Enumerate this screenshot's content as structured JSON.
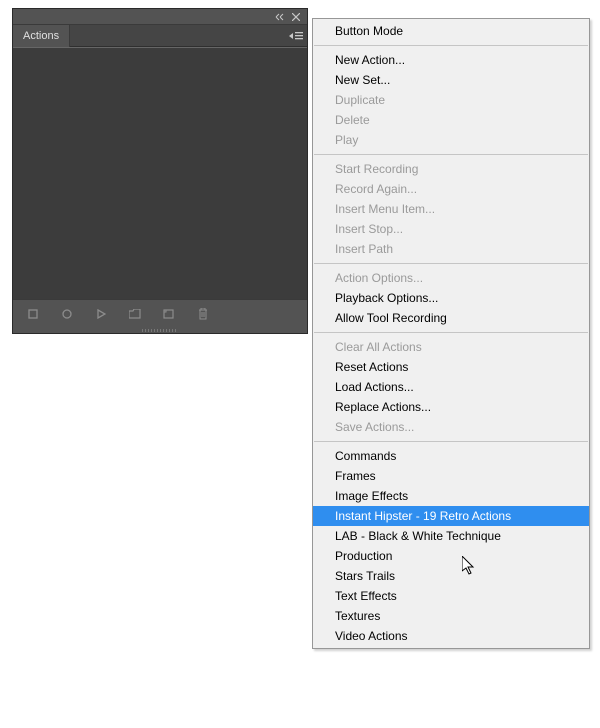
{
  "panel": {
    "tab_label": "Actions"
  },
  "menu": {
    "sections": [
      [
        {
          "label": "Button Mode",
          "enabled": true
        }
      ],
      [
        {
          "label": "New Action...",
          "enabled": true
        },
        {
          "label": "New Set...",
          "enabled": true
        },
        {
          "label": "Duplicate",
          "enabled": false
        },
        {
          "label": "Delete",
          "enabled": false
        },
        {
          "label": "Play",
          "enabled": false
        }
      ],
      [
        {
          "label": "Start Recording",
          "enabled": false
        },
        {
          "label": "Record Again...",
          "enabled": false
        },
        {
          "label": "Insert Menu Item...",
          "enabled": false
        },
        {
          "label": "Insert Stop...",
          "enabled": false
        },
        {
          "label": "Insert Path",
          "enabled": false
        }
      ],
      [
        {
          "label": "Action Options...",
          "enabled": false
        },
        {
          "label": "Playback Options...",
          "enabled": true
        },
        {
          "label": "Allow Tool Recording",
          "enabled": true
        }
      ],
      [
        {
          "label": "Clear All Actions",
          "enabled": false
        },
        {
          "label": "Reset Actions",
          "enabled": true
        },
        {
          "label": "Load Actions...",
          "enabled": true
        },
        {
          "label": "Replace Actions...",
          "enabled": true
        },
        {
          "label": "Save Actions...",
          "enabled": false
        }
      ],
      [
        {
          "label": "Commands",
          "enabled": true
        },
        {
          "label": "Frames",
          "enabled": true
        },
        {
          "label": "Image Effects",
          "enabled": true
        },
        {
          "label": "Instant Hipster - 19 Retro Actions",
          "enabled": true,
          "highlight": true
        },
        {
          "label": "LAB - Black & White Technique",
          "enabled": true
        },
        {
          "label": "Production",
          "enabled": true
        },
        {
          "label": "Stars Trails",
          "enabled": true
        },
        {
          "label": "Text Effects",
          "enabled": true
        },
        {
          "label": "Textures",
          "enabled": true
        },
        {
          "label": "Video Actions",
          "enabled": true
        }
      ]
    ]
  }
}
